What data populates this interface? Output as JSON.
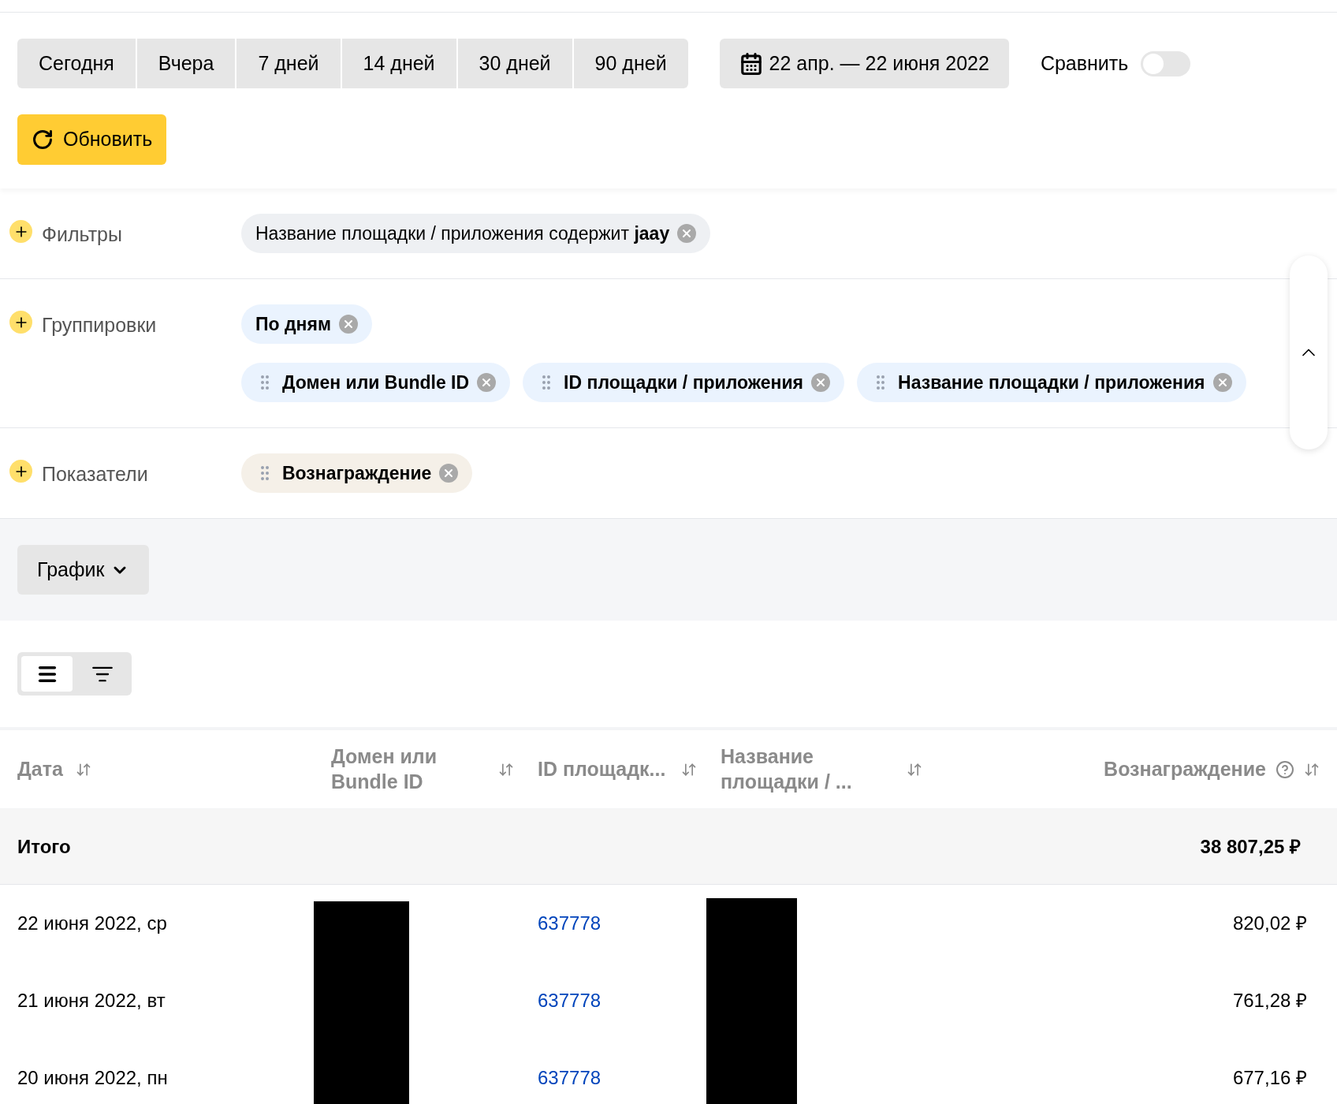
{
  "periods": [
    {
      "label": "Сегодня",
      "selected": false
    },
    {
      "label": "Вчера",
      "selected": false
    },
    {
      "label": "7 дней",
      "selected": false
    },
    {
      "label": "14 дней",
      "selected": false
    },
    {
      "label": "30 дней",
      "selected": false
    },
    {
      "label": "90 дней",
      "selected": false
    }
  ],
  "date_range": "22 апр. — 22 июня 2022",
  "compare": {
    "label": "Сравнить",
    "on": false
  },
  "refresh_button": "Обновить",
  "sections": [
    {
      "label": "Фильтры",
      "kind": "filter",
      "chips": [
        {
          "text": "Название площадки / приложения содержит **jaay**",
          "draggable": false
        }
      ]
    },
    {
      "label": "Группировки",
      "kind": "grouping",
      "chips": [
        {
          "text": "По дням",
          "draggable": false
        },
        {
          "text": "Домен или Bundle ID",
          "draggable": true
        },
        {
          "text": "ID площадки / приложения",
          "draggable": true
        },
        {
          "text": "Название площадки / приложения",
          "draggable": true
        }
      ]
    },
    {
      "label": "Показатели",
      "kind": "metric",
      "chips": [
        {
          "text": "Вознаграждение",
          "draggable": true
        }
      ]
    }
  ],
  "chart_button": "График",
  "view_modes": [
    {
      "kind": "flat",
      "selected": true
    },
    {
      "kind": "tree",
      "selected": false
    }
  ],
  "table": {
    "columns": [
      "Дата",
      "Домен или Bundle ID",
      "ID площадк...",
      "Название площадки / ...",
      "Вознаграждение"
    ],
    "total": {
      "label": "Итого",
      "reward": "38 807,25 ₽"
    },
    "rows": [
      {
        "date": "22 июня 2022, ср",
        "id": "637778",
        "reward": "820,02 ₽"
      },
      {
        "date": "21 июня 2022, вт",
        "id": "637778",
        "reward": "761,28 ₽"
      },
      {
        "date": "20 июня 2022, пн",
        "id": "637778",
        "reward": "677,16 ₽"
      }
    ]
  }
}
